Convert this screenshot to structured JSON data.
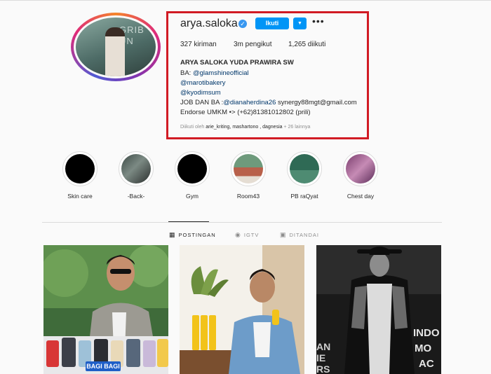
{
  "profile": {
    "username": "arya.saloka",
    "follow_label": "Ikuti",
    "dropdown_icon": "chevron-down-icon",
    "more_icon": "more-icon",
    "avatar_text": "GRIB\nUN"
  },
  "stats": {
    "posts": "327 kiriman",
    "followers": "3m pengikut",
    "following": "1,265 diikuti"
  },
  "bio": {
    "name": "ARYA SALOKA YUDA PRAWIRA SW",
    "line1_prefix": "BA: ",
    "line1_link": "@glamshineofficial",
    "line2_link": "@marotibakery",
    "line3_link": "@kyodimsum",
    "line4_prefix": "JOB DAN BA :",
    "line4_link": "@dianaherdina26",
    "line4_suffix": " synergy88mgt@gmail.com",
    "line5": "Endorse UMKM •> (+62)81381012802 (prili)",
    "followed_by_prefix": "Diikuti oleh ",
    "followed_by_users": "arie_kriting, mashartono , dagnesia",
    "followed_by_suffix": " + 26 lainnya"
  },
  "highlights": [
    {
      "label": "Skin care"
    },
    {
      "label": "-Back-"
    },
    {
      "label": "Gym"
    },
    {
      "label": "Room43"
    },
    {
      "label": "PB raQyat"
    },
    {
      "label": "Chest day"
    }
  ],
  "tabs": [
    {
      "label": "POSTINGAN",
      "icon": "grid-icon",
      "active": true
    },
    {
      "label": "IGTV",
      "icon": "igtv-icon",
      "active": false
    },
    {
      "label": "DITANDAI",
      "icon": "tagged-icon",
      "active": false
    }
  ],
  "post1": {
    "text": "BAGI BAGI"
  },
  "post3": {
    "text": "INDO\nMO\nAN\nIE\nRS"
  },
  "colors": {
    "accent": "#0095f6",
    "highlight_box": "#d11b24",
    "link": "#00376b"
  }
}
